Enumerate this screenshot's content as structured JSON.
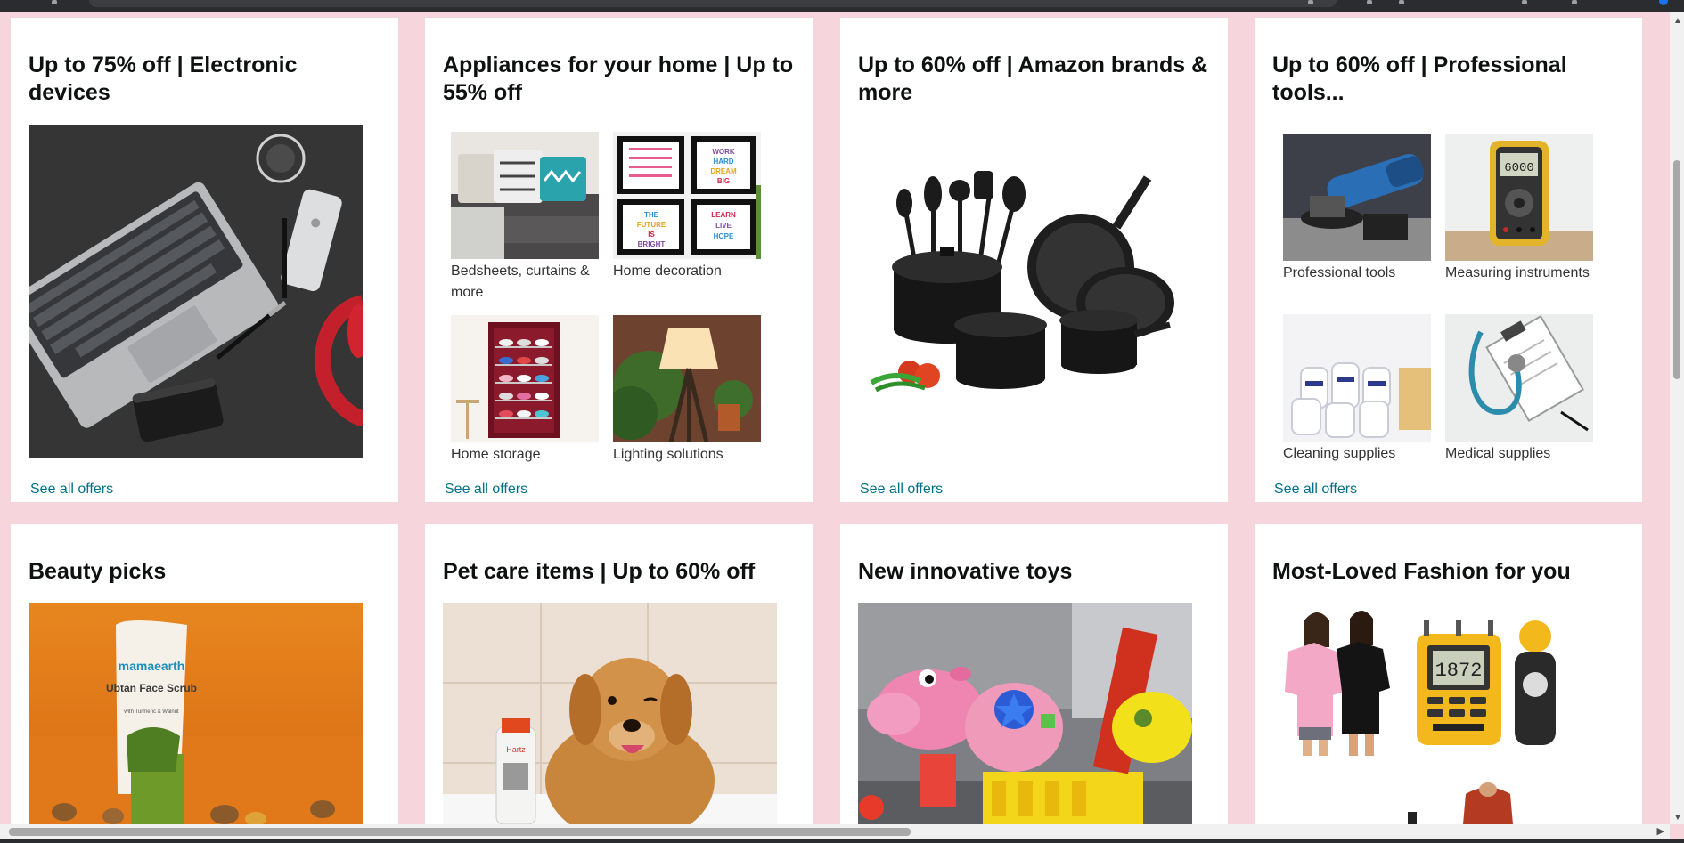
{
  "cards_top": [
    {
      "title": "Up to 75% off | Electronic devices",
      "link": "See all offers"
    },
    {
      "title": "Appliances for your home | Up to 55% off",
      "link": "See all offers",
      "items": [
        "Bedsheets, curtains & more",
        "Home decoration",
        "Home storage",
        "Lighting solutions"
      ]
    },
    {
      "title": "Up to 60% off | Amazon brands & more",
      "link": "See all offers"
    },
    {
      "title": "Up to 60% off | Professional tools...",
      "link": "See all offers",
      "items": [
        "Professional tools",
        "Measuring instruments",
        "Cleaning supplies",
        "Medical supplies"
      ]
    }
  ],
  "cards_bottom": [
    {
      "title": "Beauty picks",
      "product_brand": "mamaearth",
      "product_name": "Ubtan Face Scrub",
      "product_sub": "with Turmeric & Walnut"
    },
    {
      "title": "Pet care items | Up to 60% off",
      "product_brand": "Hartz"
    },
    {
      "title": "New innovative toys"
    },
    {
      "title": "Most-Loved Fashion for you",
      "meter_reading": "1872"
    }
  ],
  "poster_texts": [
    "WORK HARD DREAM BIG",
    "THE FUTURE IS BRIGHT",
    "LEARN LIVE HOPE"
  ],
  "multimeter_reading": "6000",
  "colors": {
    "page_bg": "#f7d5dc",
    "card_bg": "#ffffff",
    "link": "#007185",
    "title": "#0f1111"
  }
}
